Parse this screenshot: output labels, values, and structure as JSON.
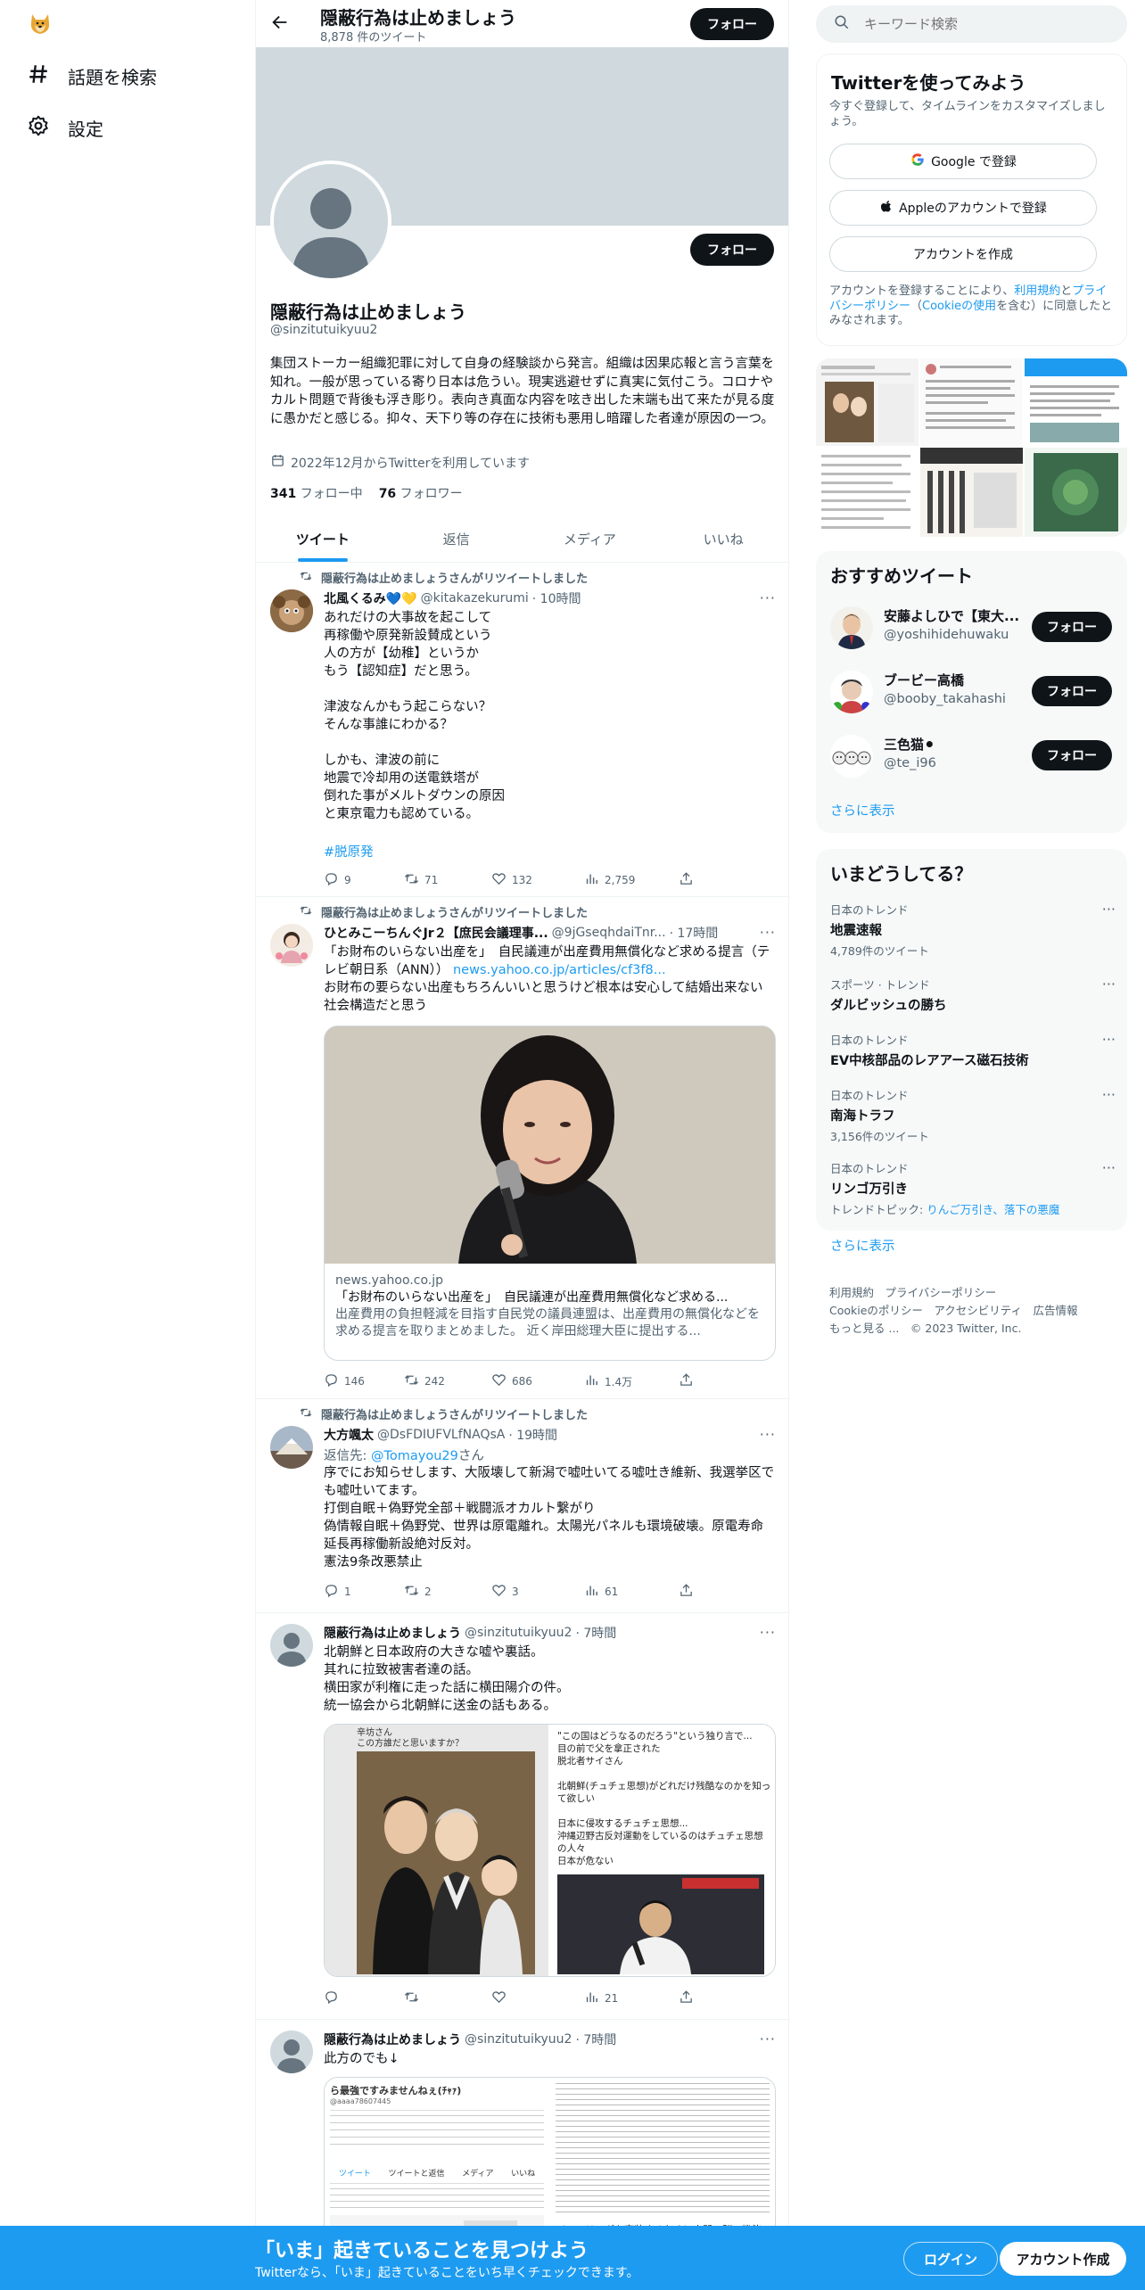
{
  "nav": {
    "items": [
      {
        "label": "話題を検索",
        "icon": "hashtag-icon"
      },
      {
        "label": "設定",
        "icon": "gear-icon"
      }
    ]
  },
  "header": {
    "name": "隠蔽行為は止めましょう",
    "tweet_count": "8,878 件のツイート",
    "follow_label": "フォロー"
  },
  "profile": {
    "name": "隠蔽行為は止めましょう",
    "handle": "@sinzitutuikyuu2",
    "follow_label": "フォロー",
    "bio": "集団ストーカー組織犯罪に対して自身の経験談から発言。組織は因果応報と言う言葉を知れ。一般が思っている寄り日本は危うい。現実逃避せずに真実に気付こう。コロナやカルト問題で背後も浮き彫り。表向き真面な内容を呟き出した末端も出て来たが見る度に愚かだと感じる。抑々、天下り等の存在に技術も悪用し暗躍した者達が原因の一つ。",
    "joined": "2022年12月からTwitterを利用しています",
    "following_count": "341",
    "following_label": "フォロー中",
    "followers_count": "76",
    "followers_label": "フォロワー"
  },
  "tabs": [
    "ツイート",
    "返信",
    "メディア",
    "いいね"
  ],
  "tweets": [
    {
      "retweet_note": "隠蔽行為は止めましょうさんがリツイートしました",
      "name": "北風くるみ💙💛",
      "handle": "@kitakazekurumi",
      "time": "· 10時間",
      "text": "あれだけの大事故を起こして\n再稼働や原発新設賛成という\n人の方が【幼稚】というか\nもう【認知症】だと思う。\n\n津波なんかもう起こらない？\nそんな事誰にわかる？\n\nしかも、津波の前に\n地震で冷却用の送電鉄塔が\n倒れた事がメルトダウンの原因\nと東京電力も認めている。",
      "hashtag": "#脱原発",
      "replies": "9",
      "retweets": "71",
      "likes": "132",
      "views": "2,759"
    },
    {
      "retweet_note": "隠蔽行為は止めましょうさんがリツイートしました",
      "name": "ひとみこーちんぐJr２【庶民会議理事...",
      "handle": "@9jGseqhdaiTnr...",
      "time": "· 17時間",
      "text_a": "「お財布のいらない出産を」　自民議連が出産費用無償化など求める提言（テレビ朝日系（ANN））",
      "link": "news.yahoo.co.jp/articles/cf3f8...",
      "text_b": "お財布の要らない出産もちろんいいと思うけど根本は安心して結婚出来ない社会構造だと思う",
      "card_domain": "news.yahoo.co.jp",
      "card_title": "「お財布のいらない出産を」　自民議連が出産費用無償化など求める...",
      "card_desc": "出産費用の負担軽減を目指す自民党の議員連盟は、出産費用の無償化などを求める提言を取りまとめました。 近く岸田総理大臣に提出する...",
      "replies": "146",
      "retweets": "242",
      "likes": "686",
      "views": "1.4万"
    },
    {
      "retweet_note": "隠蔽行為は止めましょうさんがリツイートしました",
      "name": "大方颯太",
      "handle": "@DsFDIUFVLfNAQsA",
      "time": "· 19時間",
      "reply_to_label": "返信先:",
      "reply_to": "@Tomayou29",
      "reply_to_suffix": "さん",
      "text": "序でにお知らせします、大阪壊して新潟で嘘吐いてる嘘吐き維新、我選挙区でも嘘吐いてます。\n打倒自眠＋偽野党全部＋戦闘派オカルト繋がり\n偽情報自眠＋偽野党、世界は原電離れ。太陽光パネルも環境破壊。原電寿命延長再稼働新設絶対反対。\n憲法9条改悪禁止",
      "replies": "1",
      "retweets": "2",
      "likes": "3",
      "views": "61"
    },
    {
      "name": "隠蔽行為は止めましょう",
      "handle": "@sinzitutuikyuu2",
      "time": "· 7時間",
      "text": "北朝鮮と日本政府の大きな嘘や裏話。\n其れに拉致被害者達の話。\n横田家が利権に走った話に横田陽介の件。\n統一協会から北朝鮮に送金の話もある。",
      "img_a_caption": "辛坊さん\nこの方誰だと思いますか？",
      "img_b_text": "\"この国はどうなるのだろう\"という独り言で...\n目の前で父を拿正された\n脱北者サイさん\n\n北朝鮮(チュチェ思想)がどれだけ残酷なのかを知って欲しい\n\n日本に侵攻するチュチェ思想...\n沖縄辺野古反対運動をしているのはチュチェ思想の人々\n日本が危ない",
      "replies": "",
      "retweets": "",
      "likes": "",
      "views": "21"
    },
    {
      "name": "隠蔽行為は止めましょう",
      "handle": "@sinzitutuikyuu2",
      "time": "· 7時間",
      "text": "此方のでも↓",
      "img_title": "ら最強ですみませんねぇ(ﾁｬｧ)",
      "img_handle": "@aaaa78607445",
      "img_tabs": [
        "ツイート",
        "ツイートと返信",
        "メディア",
        "いいね"
      ],
      "img_right_caption": "ジニアリングを実装するために人間の脳の機能"
    }
  ],
  "search": {
    "placeholder": "キーワード検索"
  },
  "signup": {
    "title": "Twitterを使ってみよう",
    "subtitle": "今すぐ登録して、タイムラインをカスタマイズしましょう。",
    "google_label": "Google で登録",
    "apple_label": "Appleのアカウントで登録",
    "create_label": "アカウントを作成",
    "terms_pre": "アカウントを登録することにより、",
    "terms_link1": "利用規約",
    "terms_mid1": "と",
    "terms_link2": "プライバシーポリシー",
    "terms_mid2": "（",
    "terms_link3": "Cookieの使用",
    "terms_post": "を含む）に同意したとみなされます。"
  },
  "recommended": {
    "title": "おすすめツイート",
    "users": [
      {
        "name": "安藤よしひで【東大...",
        "handle": "@yoshihidehuwaku",
        "follow": "フォロー"
      },
      {
        "name": "ブービー高橋",
        "handle": "@booby_takahashi",
        "follow": "フォロー"
      },
      {
        "name": "三色猫⚫",
        "handle": "@te_i96",
        "follow": "フォロー"
      }
    ],
    "more": "さらに表示"
  },
  "trends": {
    "title": "いまどうしてる？",
    "items": [
      {
        "category": "日本のトレンド",
        "name": "地震速報",
        "count": "4,789件のツイート"
      },
      {
        "category": "スポーツ · トレンド",
        "name": "ダルビッシュの勝ち",
        "count": ""
      },
      {
        "category": "日本のトレンド",
        "name": "EV中核部品のレアアース磁石技術",
        "count": ""
      },
      {
        "category": "日本のトレンド",
        "name": "南海トラフ",
        "count": "3,156件のツイート"
      },
      {
        "category": "日本のトレンド",
        "name": "リンゴ万引き",
        "count": "",
        "topic_label": "トレンドトピック:",
        "topics": "りんご万引き、落下の悪魔"
      }
    ],
    "more": "さらに表示"
  },
  "footer": {
    "line1": "利用規約　プライバシーポリシー",
    "line2": "Cookieのポリシー　アクセシビリティ　広告情報",
    "line3": "もっと見る ...　© 2023 Twitter, Inc."
  },
  "bottom": {
    "title": "「いま」起きていることを見つけよう",
    "subtitle": "Twitterなら、「いま」起きていることをいち早くチェックできます。",
    "login": "ログイン",
    "signup": "アカウント作成"
  },
  "colors": {
    "accent": "#1d9bf0",
    "text": "#0f1419",
    "muted": "#536471"
  }
}
